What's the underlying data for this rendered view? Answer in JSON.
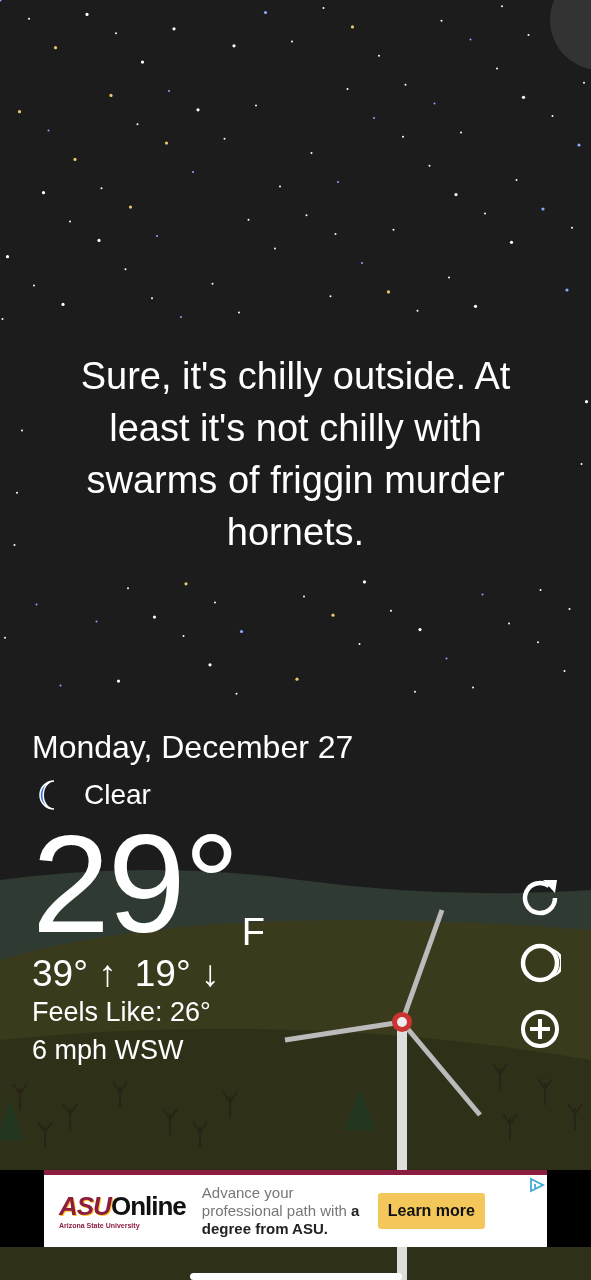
{
  "quote": "Sure, it's chilly outside. At least it's not chilly with swarms of friggin murder hornets.",
  "date": "Monday, December 27",
  "condition": {
    "label": "Clear"
  },
  "temperature": {
    "value": "29°",
    "unit": "F"
  },
  "high": "39° ↑",
  "low": "19° ↓",
  "feels_like": "Feels Like: 26°",
  "wind": "6 mph WSW",
  "actions": [
    {
      "kind": "refresh"
    },
    {
      "kind": "moon"
    },
    {
      "kind": "add"
    }
  ],
  "ad": {
    "brand": "ASU",
    "brand_suffix": "Online",
    "tagline": "Arizona State University",
    "message": "Advance your professional path with **a degree from ASU.**",
    "button": "Learn more"
  }
}
